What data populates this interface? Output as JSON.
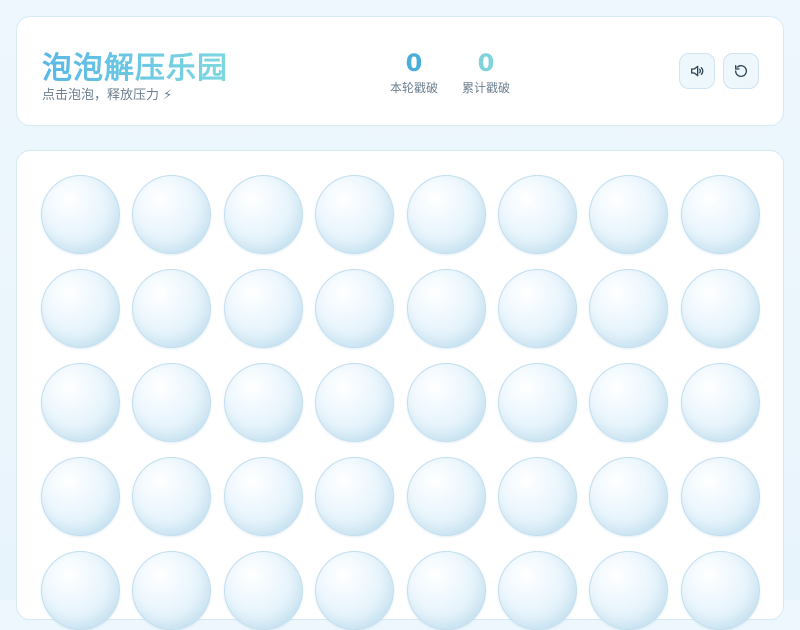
{
  "header": {
    "title": "泡泡解压乐园",
    "subtitle": "点击泡泡，释放压力 ⚡"
  },
  "stats": {
    "round": {
      "value": "0",
      "label": "本轮戳破"
    },
    "total": {
      "value": "0",
      "label": "累计戳破"
    }
  },
  "controls": {
    "sound_icon": "speaker-icon",
    "reset_icon": "refresh-icon"
  },
  "board": {
    "columns": 8,
    "bubble_count": 40
  },
  "colors": {
    "title_gradient_start": "#5ab8e6",
    "title_gradient_end": "#7ed8e0",
    "round_stat": "#4aaed8",
    "total_stat": "#7ed4da",
    "bubble_border": "#c3deee"
  }
}
